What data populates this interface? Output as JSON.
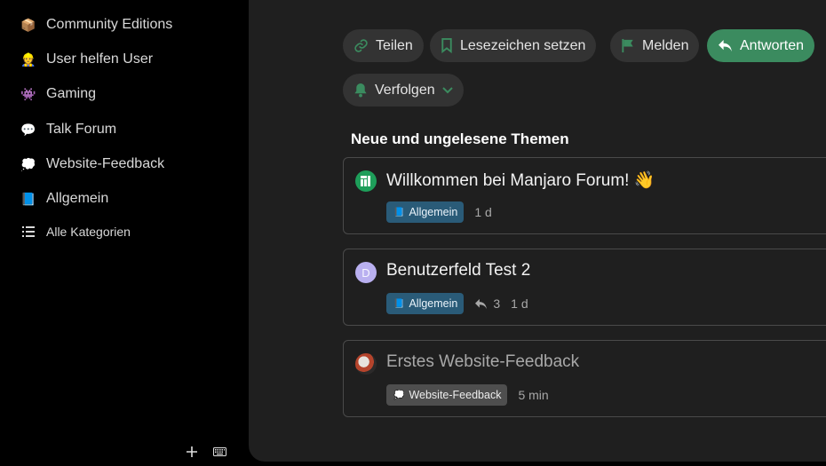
{
  "sidebar": {
    "items": [
      {
        "label": "Community Editions",
        "icon": "📦"
      },
      {
        "label": "User helfen User",
        "icon": "👷"
      },
      {
        "label": "Gaming",
        "icon": "👾"
      },
      {
        "label": "Talk Forum",
        "icon": "💬"
      },
      {
        "label": "Website-Feedback",
        "icon": "💭"
      },
      {
        "label": "Allgemein",
        "icon": "📘"
      },
      {
        "label": "Alle Kategorien",
        "icon": "list-icon"
      }
    ],
    "footer": {
      "add": "+",
      "keyboard": "⌨"
    }
  },
  "toolbar": {
    "share_label": "Teilen",
    "bookmark_label": "Lesezeichen setzen",
    "flag_label": "Melden",
    "reply_label": "Antworten",
    "follow_label": "Verfolgen"
  },
  "section": {
    "title": "Neue und ungelesene Themen"
  },
  "topics": [
    {
      "title": "Willkommen bei Manjaro Forum! 👋",
      "category": "Allgemein",
      "category_icon": "📘",
      "replies": "",
      "age": "1 d"
    },
    {
      "title": "Benutzerfeld Test 2",
      "avatar_letter": "D",
      "category": "Allgemein",
      "category_icon": "📘",
      "replies": "3",
      "age": "1 d"
    },
    {
      "title": "Erstes Website-Feedback",
      "category": "Website-Feedback",
      "category_icon": "💭",
      "replies": "",
      "age": "5 min"
    }
  ],
  "colors": {
    "accent": "#3b8b5f",
    "category_allgemein": "#2a5b78",
    "category_feedback": "#4e4e4e"
  }
}
